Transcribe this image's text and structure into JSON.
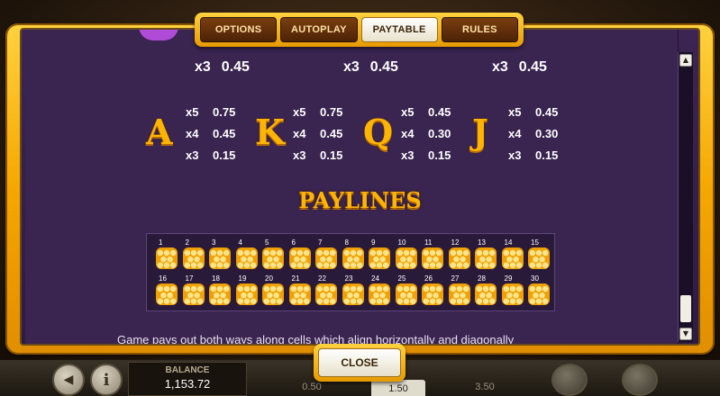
{
  "tabs": [
    {
      "label": "OPTIONS"
    },
    {
      "label": "AUTOPLAY"
    },
    {
      "label": "PAYTABLE",
      "active": true
    },
    {
      "label": "RULES"
    }
  ],
  "top_symbols": [
    {
      "name": "purple-symbol",
      "mult": "x3",
      "value": "0.45",
      "color": "#b04bd8"
    },
    {
      "name": "red-symbol",
      "mult": "x3",
      "value": "0.45",
      "color": "#e03a4a"
    },
    {
      "name": "blue-symbol",
      "mult": "x3",
      "value": "0.45",
      "color": "#2a8cf0"
    }
  ],
  "letter_symbols": [
    {
      "letter": "A",
      "pays": [
        {
          "mult": "x5",
          "value": "0.75"
        },
        {
          "mult": "x4",
          "value": "0.45"
        },
        {
          "mult": "x3",
          "value": "0.15"
        }
      ]
    },
    {
      "letter": "K",
      "pays": [
        {
          "mult": "x5",
          "value": "0.75"
        },
        {
          "mult": "x4",
          "value": "0.45"
        },
        {
          "mult": "x3",
          "value": "0.15"
        }
      ]
    },
    {
      "letter": "Q",
      "pays": [
        {
          "mult": "x5",
          "value": "0.45"
        },
        {
          "mult": "x4",
          "value": "0.30"
        },
        {
          "mult": "x3",
          "value": "0.15"
        }
      ]
    },
    {
      "letter": "J",
      "pays": [
        {
          "mult": "x5",
          "value": "0.45"
        },
        {
          "mult": "x4",
          "value": "0.30"
        },
        {
          "mult": "x3",
          "value": "0.15"
        }
      ]
    }
  ],
  "paylines_title": "PAYLINES",
  "paylines_row1": [
    "1",
    "2",
    "3",
    "4",
    "5",
    "6",
    "7",
    "8",
    "9",
    "10",
    "11",
    "12",
    "13",
    "14",
    "15"
  ],
  "paylines_row2": [
    "16",
    "17",
    "18",
    "19",
    "20",
    "21",
    "22",
    "23",
    "24",
    "25",
    "26",
    "27",
    "28",
    "29",
    "30"
  ],
  "description": "Game pays out both ways along cells which align horizontally and diagonally",
  "close_label": "CLOSE",
  "balance": {
    "label": "BALANCE",
    "value": "1,153.72"
  },
  "bets": [
    "0.50",
    "1.50",
    "3.50"
  ],
  "info_label": "i",
  "colors": {
    "honey": "#ffb400",
    "panel": "#3a2450",
    "frame": "#f5a700"
  }
}
